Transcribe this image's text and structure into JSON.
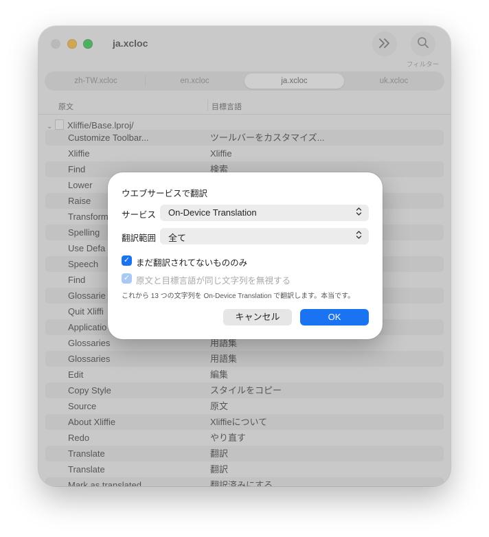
{
  "window": {
    "title": "ja.xcloc",
    "filter_label": "フィルター",
    "more_icon": "chevron-double-right-icon",
    "search_icon": "magnifier-icon"
  },
  "tabs": [
    {
      "label": "zh-TW.xcloc",
      "active": false
    },
    {
      "label": "en.xcloc",
      "active": false
    },
    {
      "label": "ja.xcloc",
      "active": true
    },
    {
      "label": "uk.xcloc",
      "active": false
    }
  ],
  "columns": {
    "source": "原文",
    "target": "目標言語"
  },
  "group": {
    "label": "Xliffie/Base.lproj/"
  },
  "rows": [
    {
      "source": "Customize Toolbar...",
      "target": "ツールバーをカスタマイズ..."
    },
    {
      "source": "Xliffie",
      "target": "Xliffie"
    },
    {
      "source": "Find",
      "target": "検索"
    },
    {
      "source": "Lower",
      "target": ""
    },
    {
      "source": "Raise",
      "target": ""
    },
    {
      "source": "Transform",
      "target": ""
    },
    {
      "source": "Spelling",
      "target": ""
    },
    {
      "source": "Use Defa",
      "target": ""
    },
    {
      "source": "Speech",
      "target": ""
    },
    {
      "source": "Find",
      "target": ""
    },
    {
      "source": "Glossarie",
      "target": ""
    },
    {
      "source": "Quit Xliffi",
      "target": ""
    },
    {
      "source": "Applicatio",
      "target": ""
    },
    {
      "source": "Glossaries",
      "target": "用語集"
    },
    {
      "source": "Glossaries",
      "target": "用語集"
    },
    {
      "source": "Edit",
      "target": "編集"
    },
    {
      "source": "Copy Style",
      "target": "スタイルをコピー"
    },
    {
      "source": "Source",
      "target": "原文"
    },
    {
      "source": "About Xliffie",
      "target": "Xliffieについて"
    },
    {
      "source": "Redo",
      "target": "やり直す"
    },
    {
      "source": "Translate",
      "target": "翻訳"
    },
    {
      "source": "Translate",
      "target": "翻訳"
    },
    {
      "source": "Mark as translated",
      "target": "翻訳済みにする"
    }
  ],
  "dialog": {
    "title": "ウエブサービスで翻訳",
    "service_label": "サービス",
    "service_value": "On-Device Translation",
    "scope_label": "翻訳範囲",
    "scope_value": "全て",
    "check_untranslated": {
      "label": "まだ翻訳されてないもののみ",
      "checked": true
    },
    "check_ignore_same": {
      "label": "原文と目標言語が同じ文字列を無視する",
      "checked": true,
      "disabled": true
    },
    "info": "これから 13 つの文字列を On-Device Translation で翻訳します。本当です。",
    "cancel": "キャンセル",
    "ok": "OK"
  },
  "colors": {
    "accent": "#1a73f0"
  }
}
